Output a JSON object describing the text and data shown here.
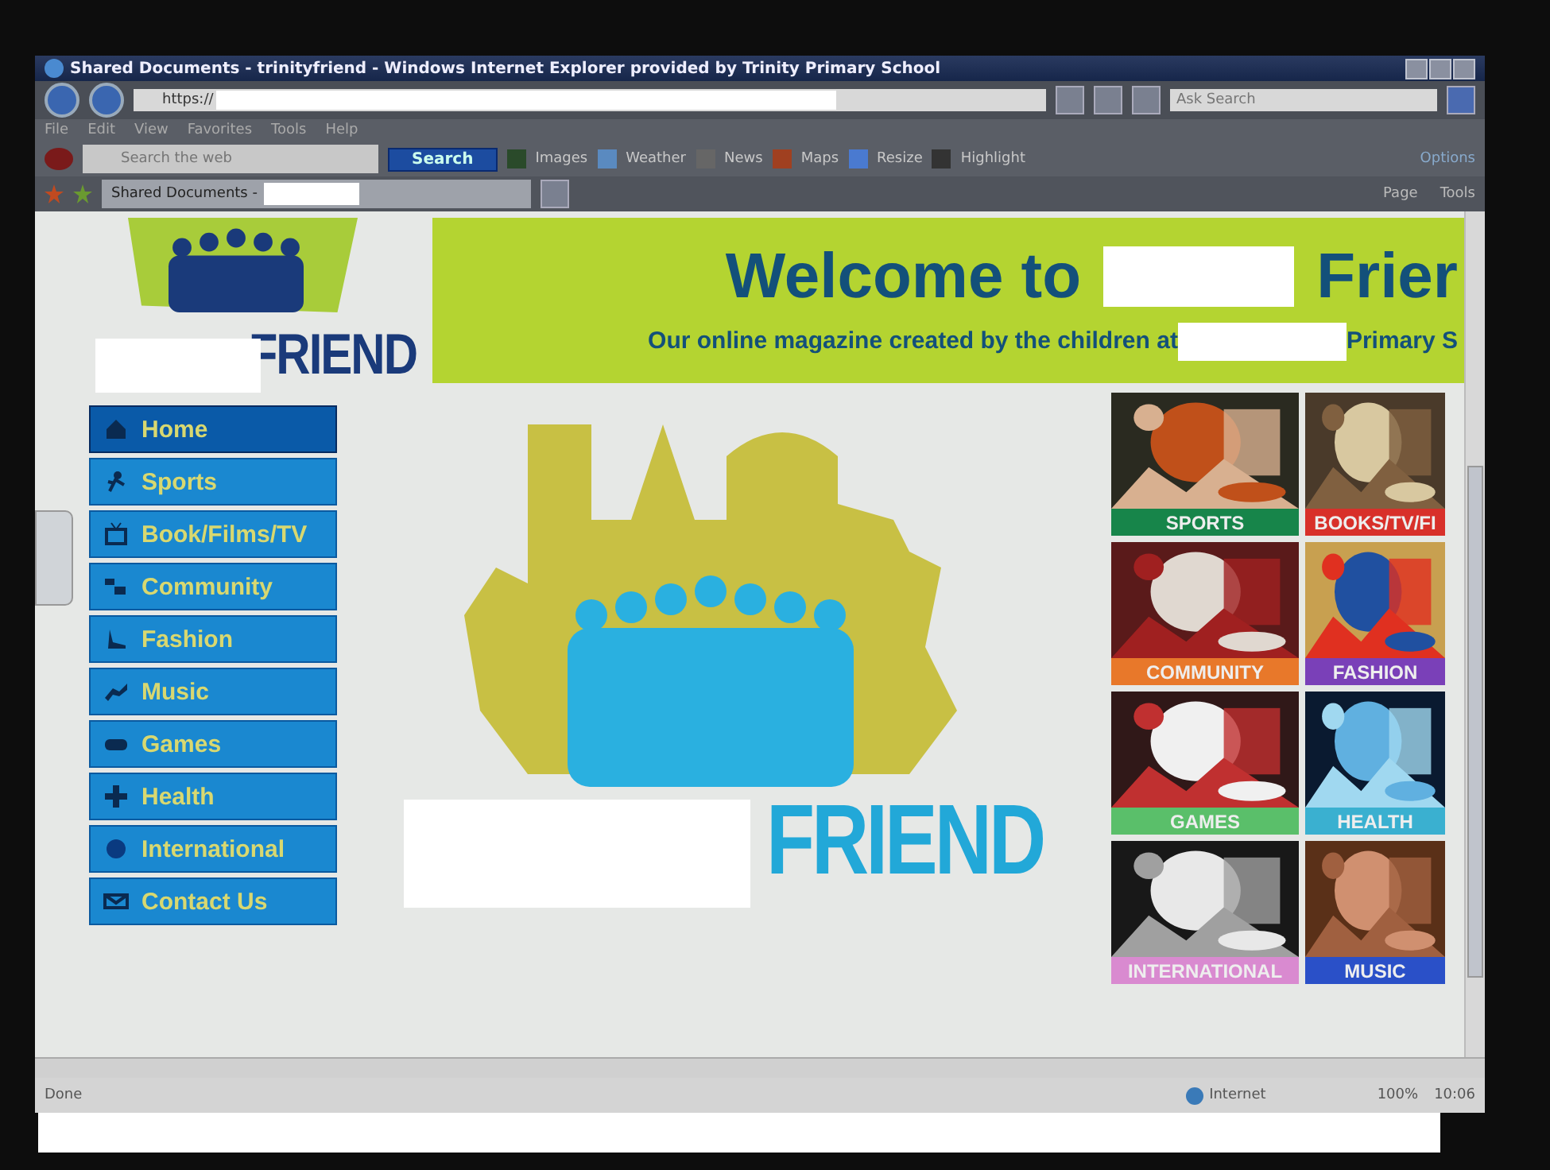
{
  "window": {
    "title": "Shared Documents - trinityfriend - Windows Internet Explorer provided by Trinity Primary School"
  },
  "address_bar": {
    "url": "https://",
    "search_placeholder": "Ask Search"
  },
  "menu": [
    "File",
    "Edit",
    "View",
    "Favorites",
    "Tools",
    "Help"
  ],
  "ask_toolbar": {
    "search_placeholder": "Search the web",
    "search_button": "Search",
    "items": [
      "Images",
      "Weather",
      "News",
      "Maps",
      "Resize",
      "Highlight"
    ],
    "options": "Options"
  },
  "tabs": [
    {
      "label": "Shared Documents -",
      "selected": true
    }
  ],
  "command_bar": [
    "Page",
    "Tools"
  ],
  "page": {
    "logo_text": "FRIEND",
    "banner": {
      "title": "Welcome to",
      "title_end": "Frier",
      "subtitle": "Our online magazine created by the children at",
      "subtitle_end": "Primary S"
    },
    "nav": [
      {
        "label": "Home",
        "selected": true
      },
      {
        "label": "Sports",
        "selected": false
      },
      {
        "label": "Book/Films/TV",
        "selected": false
      },
      {
        "label": "Community",
        "selected": false
      },
      {
        "label": "Fashion",
        "selected": false
      },
      {
        "label": "Music",
        "selected": false
      },
      {
        "label": "Games",
        "selected": false
      },
      {
        "label": "Health",
        "selected": false
      },
      {
        "label": "International",
        "selected": false
      },
      {
        "label": "Contact Us",
        "selected": false
      }
    ],
    "main_logo_text": "FRIEND",
    "tiles": [
      {
        "label": "SPORTS",
        "color": "#17854a"
      },
      {
        "label": "BOOKS/TV/FI",
        "color": "#d8302a"
      },
      {
        "label": "COMMUNITY",
        "color": "#e8782a"
      },
      {
        "label": "FASHION",
        "color": "#7a40b8"
      },
      {
        "label": "GAMES",
        "color": "#5abf6a"
      },
      {
        "label": "HEALTH",
        "color": "#3ab0d0"
      },
      {
        "label": "INTERNATIONAL",
        "color": "#d98ad0"
      },
      {
        "label": "MUSIC",
        "color": "#2a50c8"
      }
    ]
  },
  "status_bar": {
    "text": "Done",
    "zone": "Internet",
    "zoom": "100%",
    "clock": "10:06"
  }
}
